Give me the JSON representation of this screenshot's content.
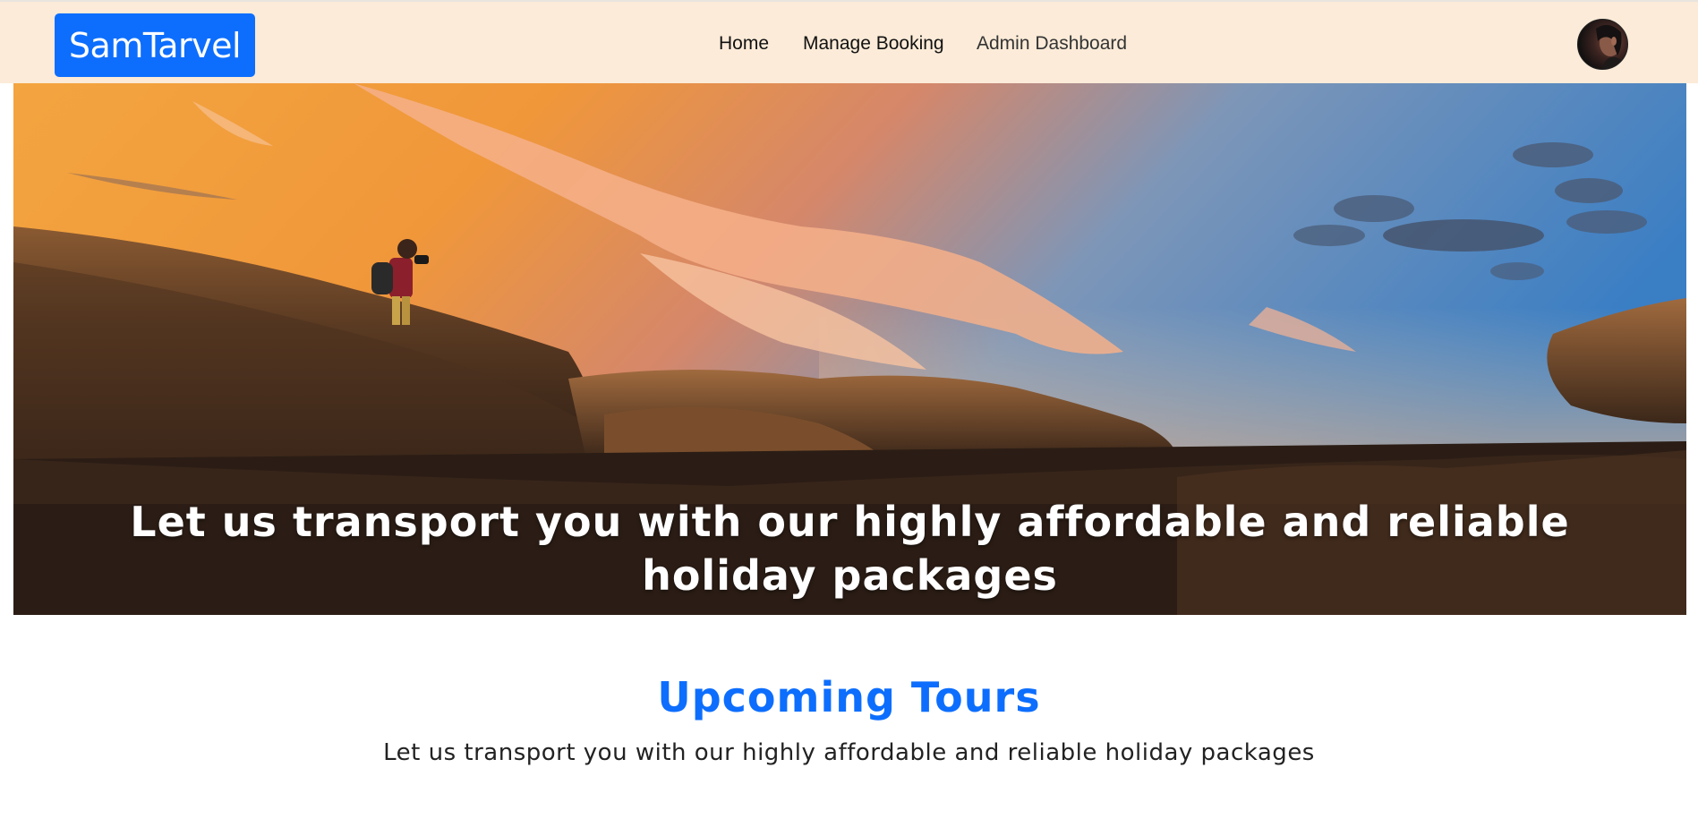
{
  "navbar": {
    "brand": "SamTarvel",
    "links": [
      {
        "label": "Home"
      },
      {
        "label": "Manage Booking"
      },
      {
        "label": "Admin Dashboard"
      }
    ],
    "avatar_icon": "user-avatar",
    "background": "#fbebd8",
    "brand_color": "#0d6efd"
  },
  "hero": {
    "title": "Let us transport you with our highly affordable and reliable holiday packages",
    "image": "photographer-on-rocks-at-sunset"
  },
  "section": {
    "title": "Upcoming Tours",
    "subtitle": "Let us transport you with our highly affordable and reliable holiday packages",
    "title_color": "#0d6efd"
  }
}
